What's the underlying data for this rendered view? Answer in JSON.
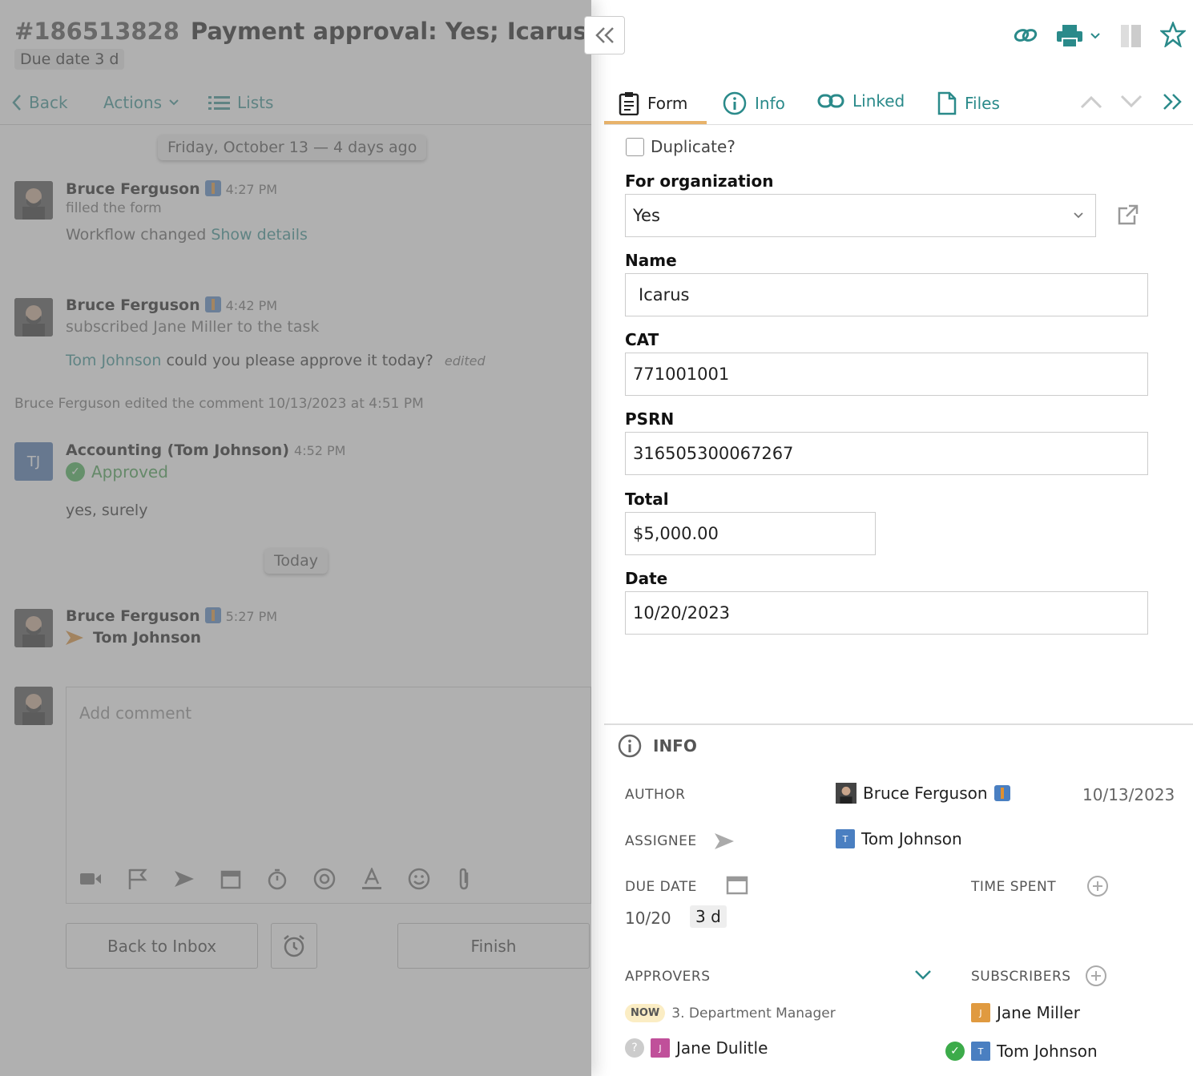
{
  "header": {
    "task_number": "#186513828",
    "title": "Payment approval: Yes;  Icarus",
    "due_badge": "Due date 3 d"
  },
  "nav": {
    "back": "Back",
    "actions": "Actions",
    "lists": "Lists"
  },
  "feed": {
    "date_separator_1": "Friday, October 13 — 4 days ago",
    "e1": {
      "author": "Bruce Ferguson",
      "time": "4:27 PM",
      "action": "filled the form",
      "line_text": "Workflow changed",
      "line_link": "Show details"
    },
    "e2": {
      "author": "Bruce Ferguson",
      "time": "4:42 PM",
      "action": "subscribed Jane Miller to the task",
      "mention": "Tom Johnson",
      "comment": " could you please approve it today?",
      "edited": "edited"
    },
    "edit_note": "Bruce Ferguson edited the comment 10/13/2023 at 4:51 PM",
    "e3": {
      "initials": "TJ",
      "author": "Accounting (Tom Johnson)",
      "time": "4:52 PM",
      "status": "Approved",
      "comment": "yes, surely"
    },
    "date_separator_2": "Today",
    "e4": {
      "author": "Bruce Ferguson",
      "time": "5:27 PM",
      "assignee": "Tom Johnson"
    }
  },
  "composer": {
    "placeholder": "Add comment"
  },
  "bottom": {
    "back_to_inbox": "Back to Inbox",
    "finish": "Finish"
  },
  "tabs": {
    "form": "Form",
    "info": "Info",
    "linked": "Linked",
    "files": "Files"
  },
  "form": {
    "duplicate_label": "Duplicate?",
    "org_label": "For organization",
    "org_value": "Yes",
    "name_label": "Name",
    "name_value": "Icarus",
    "cat_label": "CAT",
    "cat_value": "771001001",
    "psrn_label": "PSRN",
    "psrn_value": "316505300067267",
    "total_label": "Total",
    "total_value": "$5,000.00",
    "date_label": "Date",
    "date_value": "10/20/2023"
  },
  "info": {
    "heading": "INFO",
    "author_label": "AUTHOR",
    "author_name": "Bruce Ferguson",
    "author_date": "10/13/2023",
    "assignee_label": "ASSIGNEE",
    "assignee_name": "Tom Johnson",
    "assignee_initial": "T",
    "due_label": "DUE DATE",
    "due_value": "10/20",
    "due_badge": "3 d",
    "time_spent_label": "TIME SPENT",
    "approvers_label": "APPROVERS",
    "now_badge": "NOW",
    "step": "3. Department Manager",
    "approver": "Jane Dulitle",
    "approver_initial": "J",
    "subscribers_label": "SUBSCRIBERS",
    "sub1": "Jane Miller",
    "sub1_initial": "J",
    "sub2": "Tom Johnson",
    "sub2_initial": "T"
  },
  "colors": {
    "accent": "#2a8a8a",
    "tab_underline": "#e8b36a",
    "approved": "#3cab4a",
    "star": "#2a8a8a"
  }
}
